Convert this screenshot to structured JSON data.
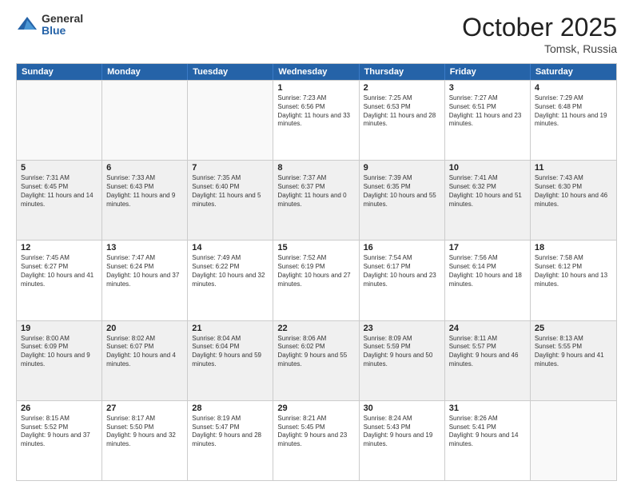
{
  "header": {
    "logo": {
      "general": "General",
      "blue": "Blue"
    },
    "title": "October 2025",
    "location": "Tomsk, Russia"
  },
  "weekdays": [
    "Sunday",
    "Monday",
    "Tuesday",
    "Wednesday",
    "Thursday",
    "Friday",
    "Saturday"
  ],
  "weeks": [
    [
      {
        "day": "",
        "sunrise": "",
        "sunset": "",
        "daylight": ""
      },
      {
        "day": "",
        "sunrise": "",
        "sunset": "",
        "daylight": ""
      },
      {
        "day": "",
        "sunrise": "",
        "sunset": "",
        "daylight": ""
      },
      {
        "day": "1",
        "sunrise": "Sunrise: 7:23 AM",
        "sunset": "Sunset: 6:56 PM",
        "daylight": "Daylight: 11 hours and 33 minutes."
      },
      {
        "day": "2",
        "sunrise": "Sunrise: 7:25 AM",
        "sunset": "Sunset: 6:53 PM",
        "daylight": "Daylight: 11 hours and 28 minutes."
      },
      {
        "day": "3",
        "sunrise": "Sunrise: 7:27 AM",
        "sunset": "Sunset: 6:51 PM",
        "daylight": "Daylight: 11 hours and 23 minutes."
      },
      {
        "day": "4",
        "sunrise": "Sunrise: 7:29 AM",
        "sunset": "Sunset: 6:48 PM",
        "daylight": "Daylight: 11 hours and 19 minutes."
      }
    ],
    [
      {
        "day": "5",
        "sunrise": "Sunrise: 7:31 AM",
        "sunset": "Sunset: 6:45 PM",
        "daylight": "Daylight: 11 hours and 14 minutes."
      },
      {
        "day": "6",
        "sunrise": "Sunrise: 7:33 AM",
        "sunset": "Sunset: 6:43 PM",
        "daylight": "Daylight: 11 hours and 9 minutes."
      },
      {
        "day": "7",
        "sunrise": "Sunrise: 7:35 AM",
        "sunset": "Sunset: 6:40 PM",
        "daylight": "Daylight: 11 hours and 5 minutes."
      },
      {
        "day": "8",
        "sunrise": "Sunrise: 7:37 AM",
        "sunset": "Sunset: 6:37 PM",
        "daylight": "Daylight: 11 hours and 0 minutes."
      },
      {
        "day": "9",
        "sunrise": "Sunrise: 7:39 AM",
        "sunset": "Sunset: 6:35 PM",
        "daylight": "Daylight: 10 hours and 55 minutes."
      },
      {
        "day": "10",
        "sunrise": "Sunrise: 7:41 AM",
        "sunset": "Sunset: 6:32 PM",
        "daylight": "Daylight: 10 hours and 51 minutes."
      },
      {
        "day": "11",
        "sunrise": "Sunrise: 7:43 AM",
        "sunset": "Sunset: 6:30 PM",
        "daylight": "Daylight: 10 hours and 46 minutes."
      }
    ],
    [
      {
        "day": "12",
        "sunrise": "Sunrise: 7:45 AM",
        "sunset": "Sunset: 6:27 PM",
        "daylight": "Daylight: 10 hours and 41 minutes."
      },
      {
        "day": "13",
        "sunrise": "Sunrise: 7:47 AM",
        "sunset": "Sunset: 6:24 PM",
        "daylight": "Daylight: 10 hours and 37 minutes."
      },
      {
        "day": "14",
        "sunrise": "Sunrise: 7:49 AM",
        "sunset": "Sunset: 6:22 PM",
        "daylight": "Daylight: 10 hours and 32 minutes."
      },
      {
        "day": "15",
        "sunrise": "Sunrise: 7:52 AM",
        "sunset": "Sunset: 6:19 PM",
        "daylight": "Daylight: 10 hours and 27 minutes."
      },
      {
        "day": "16",
        "sunrise": "Sunrise: 7:54 AM",
        "sunset": "Sunset: 6:17 PM",
        "daylight": "Daylight: 10 hours and 23 minutes."
      },
      {
        "day": "17",
        "sunrise": "Sunrise: 7:56 AM",
        "sunset": "Sunset: 6:14 PM",
        "daylight": "Daylight: 10 hours and 18 minutes."
      },
      {
        "day": "18",
        "sunrise": "Sunrise: 7:58 AM",
        "sunset": "Sunset: 6:12 PM",
        "daylight": "Daylight: 10 hours and 13 minutes."
      }
    ],
    [
      {
        "day": "19",
        "sunrise": "Sunrise: 8:00 AM",
        "sunset": "Sunset: 6:09 PM",
        "daylight": "Daylight: 10 hours and 9 minutes."
      },
      {
        "day": "20",
        "sunrise": "Sunrise: 8:02 AM",
        "sunset": "Sunset: 6:07 PM",
        "daylight": "Daylight: 10 hours and 4 minutes."
      },
      {
        "day": "21",
        "sunrise": "Sunrise: 8:04 AM",
        "sunset": "Sunset: 6:04 PM",
        "daylight": "Daylight: 9 hours and 59 minutes."
      },
      {
        "day": "22",
        "sunrise": "Sunrise: 8:06 AM",
        "sunset": "Sunset: 6:02 PM",
        "daylight": "Daylight: 9 hours and 55 minutes."
      },
      {
        "day": "23",
        "sunrise": "Sunrise: 8:09 AM",
        "sunset": "Sunset: 5:59 PM",
        "daylight": "Daylight: 9 hours and 50 minutes."
      },
      {
        "day": "24",
        "sunrise": "Sunrise: 8:11 AM",
        "sunset": "Sunset: 5:57 PM",
        "daylight": "Daylight: 9 hours and 46 minutes."
      },
      {
        "day": "25",
        "sunrise": "Sunrise: 8:13 AM",
        "sunset": "Sunset: 5:55 PM",
        "daylight": "Daylight: 9 hours and 41 minutes."
      }
    ],
    [
      {
        "day": "26",
        "sunrise": "Sunrise: 8:15 AM",
        "sunset": "Sunset: 5:52 PM",
        "daylight": "Daylight: 9 hours and 37 minutes."
      },
      {
        "day": "27",
        "sunrise": "Sunrise: 8:17 AM",
        "sunset": "Sunset: 5:50 PM",
        "daylight": "Daylight: 9 hours and 32 minutes."
      },
      {
        "day": "28",
        "sunrise": "Sunrise: 8:19 AM",
        "sunset": "Sunset: 5:47 PM",
        "daylight": "Daylight: 9 hours and 28 minutes."
      },
      {
        "day": "29",
        "sunrise": "Sunrise: 8:21 AM",
        "sunset": "Sunset: 5:45 PM",
        "daylight": "Daylight: 9 hours and 23 minutes."
      },
      {
        "day": "30",
        "sunrise": "Sunrise: 8:24 AM",
        "sunset": "Sunset: 5:43 PM",
        "daylight": "Daylight: 9 hours and 19 minutes."
      },
      {
        "day": "31",
        "sunrise": "Sunrise: 8:26 AM",
        "sunset": "Sunset: 5:41 PM",
        "daylight": "Daylight: 9 hours and 14 minutes."
      },
      {
        "day": "",
        "sunrise": "",
        "sunset": "",
        "daylight": ""
      }
    ]
  ],
  "colors": {
    "header_bg": "#2563a8",
    "alt_row_bg": "#f0f4f0",
    "border": "#cccccc"
  }
}
